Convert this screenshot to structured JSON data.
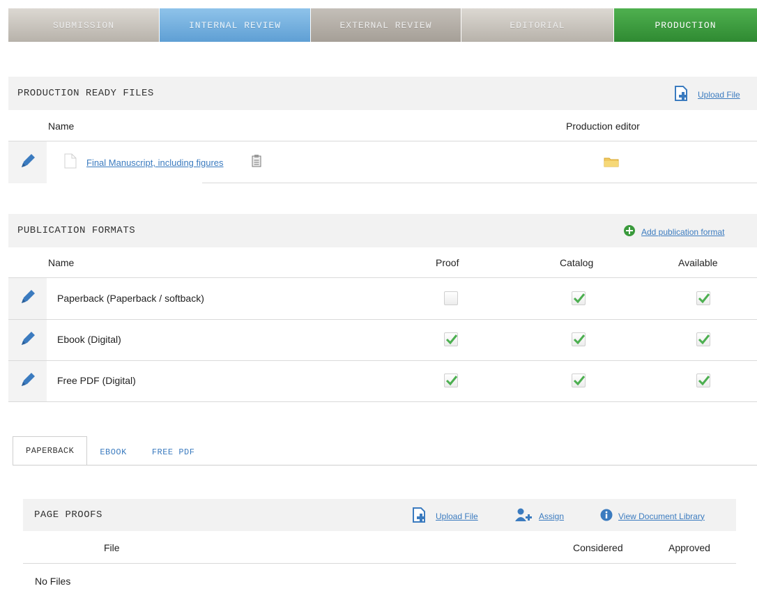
{
  "stages": [
    "SUBMISSION",
    "INTERNAL REVIEW",
    "EXTERNAL REVIEW",
    "EDITORIAL",
    "PRODUCTION"
  ],
  "production_ready": {
    "title": "PRODUCTION READY FILES",
    "upload_label": "Upload File",
    "col_name": "Name",
    "col_editor": "Production editor",
    "file_name": "Final Manuscript, including figures"
  },
  "publication_formats": {
    "title": "PUBLICATION FORMATS",
    "add_label": "Add publication format",
    "col_name": "Name",
    "col_proof": "Proof",
    "col_catalog": "Catalog",
    "col_available": "Available",
    "rows": [
      {
        "name": "Paperback (Paperback / softback)",
        "proof": false,
        "catalog": true,
        "available": true
      },
      {
        "name": "Ebook (Digital)",
        "proof": true,
        "catalog": true,
        "available": true
      },
      {
        "name": "Free PDF (Digital)",
        "proof": true,
        "catalog": true,
        "available": true
      }
    ]
  },
  "format_tabs": [
    "PAPERBACK",
    "EBOOK",
    "FREE PDF"
  ],
  "page_proofs": {
    "title": "PAGE PROOFS",
    "upload_label": "Upload File",
    "assign_label": "Assign",
    "library_label": "View Document Library",
    "col_file": "File",
    "col_considered": "Considered",
    "col_approved": "Approved",
    "empty_text": "No Files"
  },
  "colors": {
    "accent_blue": "#3b7bbf",
    "production_green": "#3a9a3c",
    "internal_review_blue": "#6fabdc",
    "check_green": "#4caf50"
  }
}
